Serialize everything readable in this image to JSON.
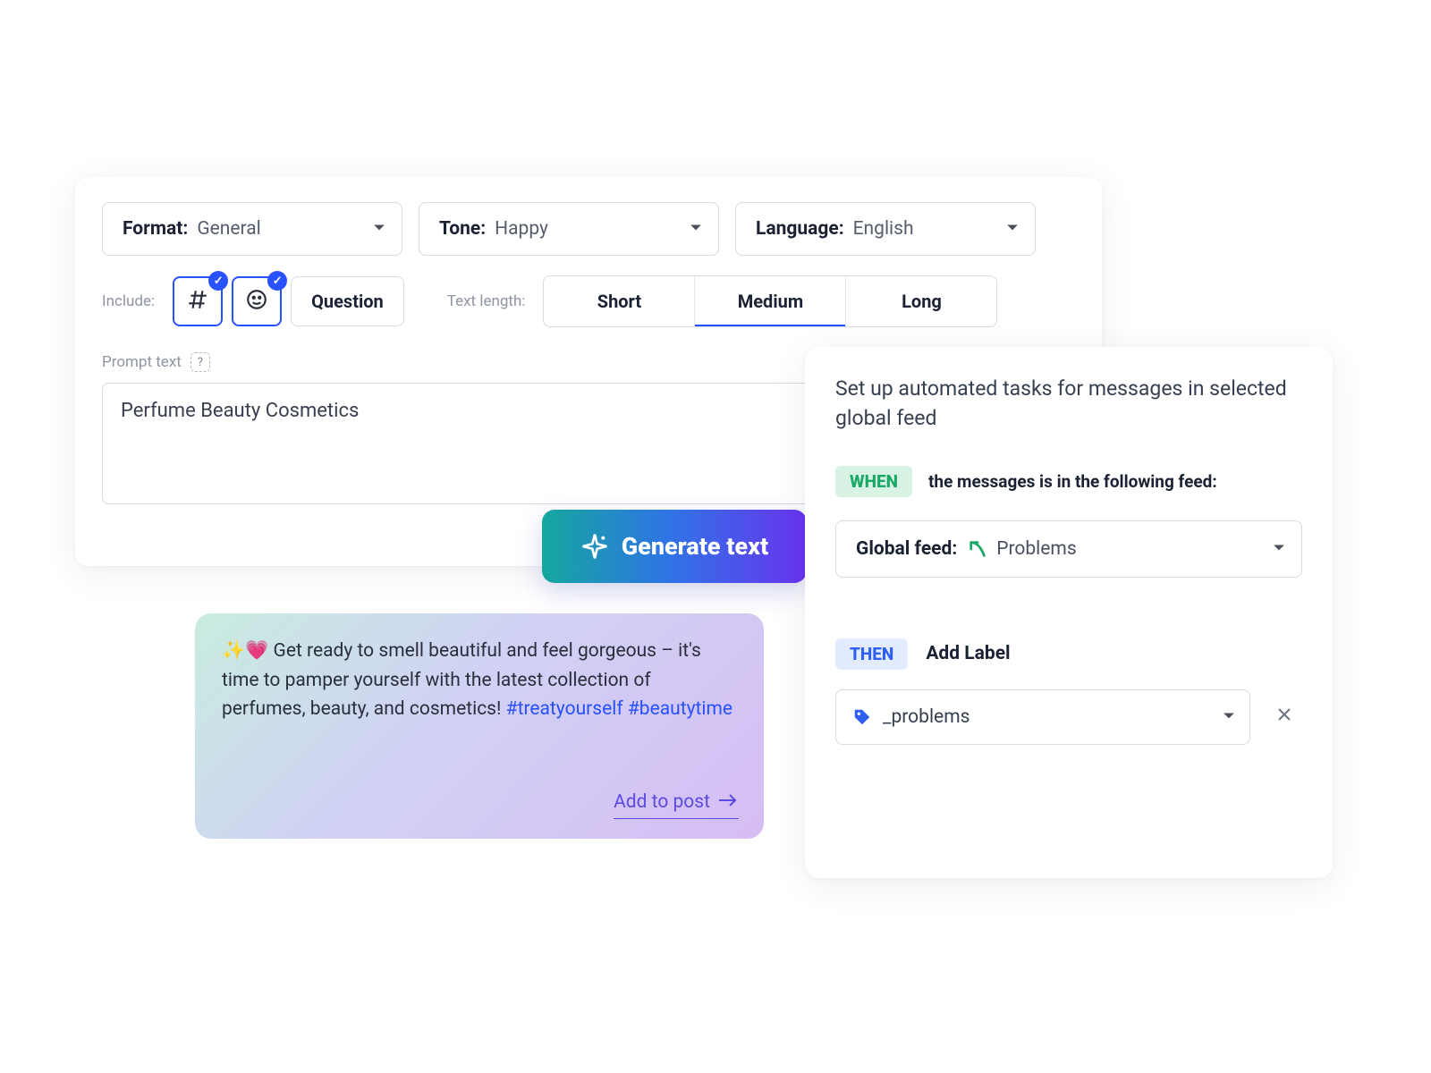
{
  "generator": {
    "format_label": "Format:",
    "format_value": "General",
    "tone_label": "Tone:",
    "tone_value": "Happy",
    "language_label": "Language:",
    "language_value": "English",
    "include_label": "Include:",
    "question_label": "Question",
    "length_label": "Text length:",
    "length_options": {
      "short": "Short",
      "medium": "Medium",
      "long": "Long"
    },
    "length_selected": "medium",
    "prompt_label": "Prompt text",
    "prompt_value": "Perfume Beauty Cosmetics",
    "generate_label": "Generate text"
  },
  "result": {
    "leading_emoji": "✨💗 ",
    "text_before_tags": "Get ready to smell beautiful and feel gorgeous – it's time to pamper yourself with the latest collection of perfumes, beauty, and cosmetics! ",
    "hashtag1": "#treatyourself",
    "hashtag2": "#beautytime",
    "add_to_post": "Add to post"
  },
  "automation": {
    "heading": "Set up automated tasks for messages in selected global feed",
    "when_tag": "WHEN",
    "when_text": "the messages is in the following feed:",
    "feed_label": "Global feed:",
    "feed_value": "Problems",
    "then_tag": "THEN",
    "then_text": "Add Label",
    "label_value": "_problems"
  }
}
